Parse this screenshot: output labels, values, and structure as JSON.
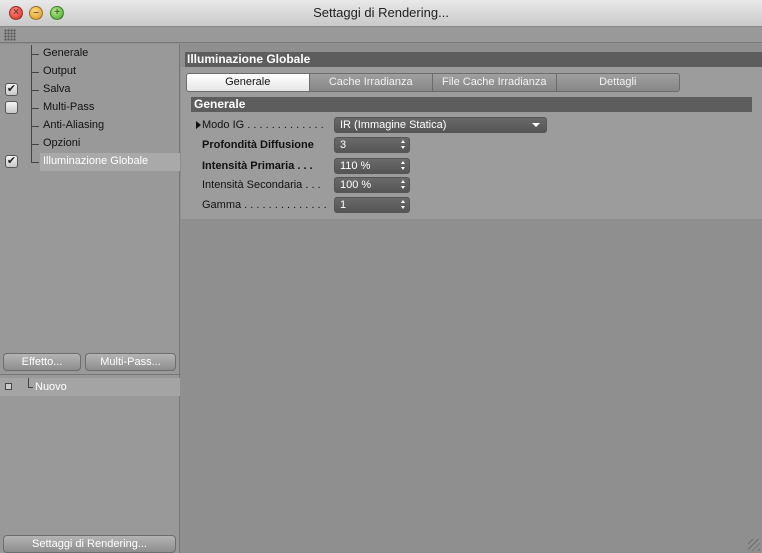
{
  "window": {
    "title": "Settaggi di Rendering..."
  },
  "sidebar": {
    "items": [
      {
        "label": "Generale",
        "checkbox": null
      },
      {
        "label": "Output",
        "checkbox": null
      },
      {
        "label": "Salva",
        "checkbox": "checked"
      },
      {
        "label": "Multi-Pass",
        "checkbox": "unchecked"
      },
      {
        "label": "Anti-Aliasing",
        "checkbox": null
      },
      {
        "label": "Opzioni",
        "checkbox": null
      },
      {
        "label": "Illuminazione Globale",
        "checkbox": "checked",
        "selected": true
      }
    ],
    "effect_button": "Effetto...",
    "multipass_button": "Multi-Pass...",
    "preset_item": "Nuovo",
    "bottom_button": "Settaggi di Rendering..."
  },
  "main": {
    "section_title": "Illuminazione Globale",
    "tabs": [
      {
        "label": "Generale",
        "active": true
      },
      {
        "label": "Cache Irradianza",
        "active": false
      },
      {
        "label": "File Cache Irradianza",
        "active": false
      },
      {
        "label": "Dettagli",
        "active": false
      }
    ],
    "subsection_title": "Generale",
    "params": [
      {
        "label": "Modo IG . . . . . . . . . . . . .",
        "value": "IR (Immagine Statica)",
        "bold": false,
        "type": "dropdown"
      },
      {
        "label": "Profondità Diffusione",
        "value": "3",
        "bold": true,
        "type": "spinner"
      },
      {
        "label": "Intensità Primaria . . .",
        "value": "110 %",
        "bold": true,
        "type": "spinner"
      },
      {
        "label": "Intensità Secondaria . . .",
        "value": "100 %",
        "bold": false,
        "type": "spinner"
      },
      {
        "label": "Gamma . . . . . . . . . . . . . .",
        "value": "1",
        "bold": false,
        "type": "spinner"
      }
    ]
  },
  "colors": {
    "panel_bg": "#999999",
    "header_bg": "#5d5d5d",
    "field_bg": "#5f5f5f"
  }
}
